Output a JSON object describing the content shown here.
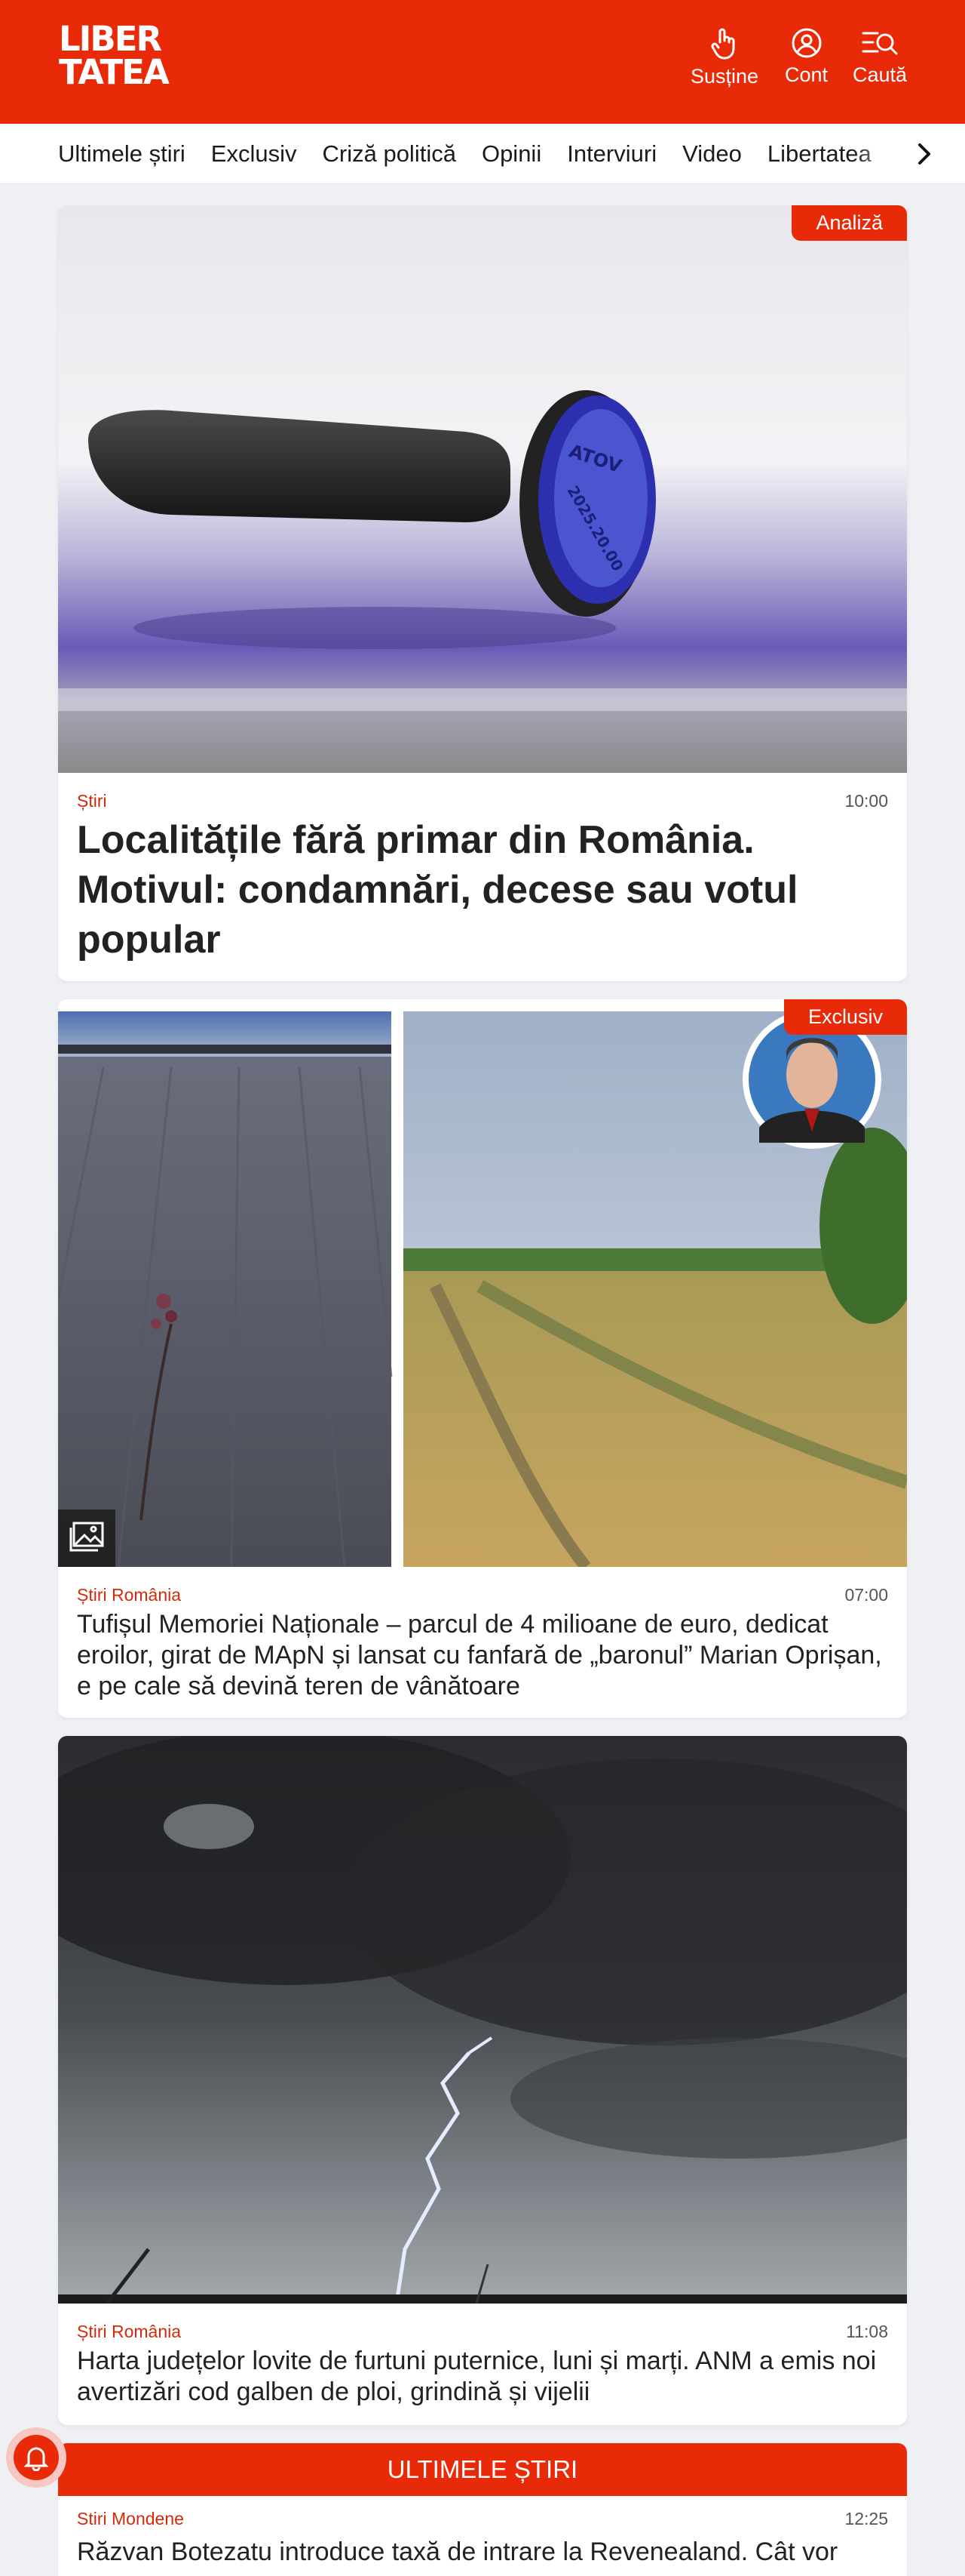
{
  "header": {
    "logo_line1": "LIBER",
    "logo_line2": "TATEA",
    "actions": [
      {
        "label": "Susține",
        "icon": "hand-heart-icon"
      },
      {
        "label": "Cont",
        "icon": "user-icon"
      },
      {
        "label": "Caută",
        "icon": "search-menu-icon"
      }
    ]
  },
  "nav": {
    "items": [
      "Ultimele știri",
      "Exclusiv",
      "Criză politică",
      "Opinii",
      "Interviuri",
      "Video",
      "Libertatea"
    ],
    "more_icon": "chevron-right-icon"
  },
  "articles": [
    {
      "badge": "Analiză",
      "category": "Știri",
      "time": "10:00",
      "title": "Localitățile fără primar din România. Motivul: condamnări, decese sau votul popular"
    },
    {
      "badge": "Exclusiv",
      "category": "Știri România",
      "time": "07:00",
      "title": "Tufișul Memoriei Naționale – parcul de 4 milioane de euro, dedicat eroilor, girat de MApN și lansat cu fanfară de „baronul” Marian Oprișan, e pe cale să devină teren de vânătoare",
      "gallery_icon": "gallery-icon"
    },
    {
      "category": "Știri România",
      "time": "11:08",
      "title": "Harta județelor lovite de furtuni puternice, luni și marți. ANM a emis noi avertizări cod galben de ploi, grindină și vijelii"
    }
  ],
  "latest": {
    "heading": "ULTIMELE ȘTIRI",
    "items": [
      {
        "category": "Stiri Mondene",
        "time": "12:25",
        "title": "Răzvan Botezatu introduce taxă de intrare la Revenealand. Cât vor"
      }
    ]
  },
  "notification_icon": "bell-icon",
  "colors": {
    "brand": "#e92a08",
    "category": "#d4290b",
    "background": "#eff0f3"
  }
}
